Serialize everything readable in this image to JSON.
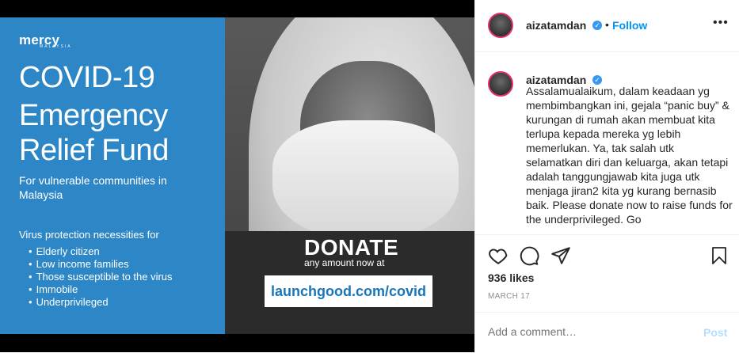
{
  "poster": {
    "logo": "mercy",
    "logo_sub": "MALAYSIA",
    "title_line1": "COVID-19",
    "title_line2": "Emergency",
    "title_line3": "Relief Fund",
    "subtitle": "For vulnerable communities in Malaysia",
    "protection_heading": "Virus protection necessities for",
    "bullets": [
      "Elderly citizen",
      "Low income families",
      "Those susceptible to the virus",
      "Immobile",
      "Underprivileged"
    ],
    "donate": "DONATE",
    "amount": "any amount now at",
    "url": "launchgood.com/covid"
  },
  "header": {
    "username": "aizatamdan",
    "separator": "•",
    "follow_label": "Follow",
    "more_label": "•••"
  },
  "caption": {
    "username": "aizatamdan",
    "text": "Assalamualaikum, dalam keadaan yg membimbangkan ini, gejala “panic buy” & kurungan di rumah akan membuat kita terlupa kepada mereka yg lebih memerlukan. Ya, tak salah utk selamatkan diri dan keluarga, akan tetapi adalah tanggungjawab kita juga utk menjaga jiran2 kita yg kurang bernasib baik. Please donate now to raise funds for the underprivileged. Go"
  },
  "likes": "936 likes",
  "date": "MARCH 17",
  "comment": {
    "placeholder": "Add a comment…",
    "post_label": "Post"
  },
  "icons": [
    "heart-icon",
    "comment-icon",
    "share-icon",
    "bookmark-icon",
    "verified-badge-icon"
  ],
  "colors": {
    "poster_blue": "#2d86c5",
    "link_blue": "#0095f6",
    "text": "#262626",
    "muted": "#8e8e8e"
  }
}
